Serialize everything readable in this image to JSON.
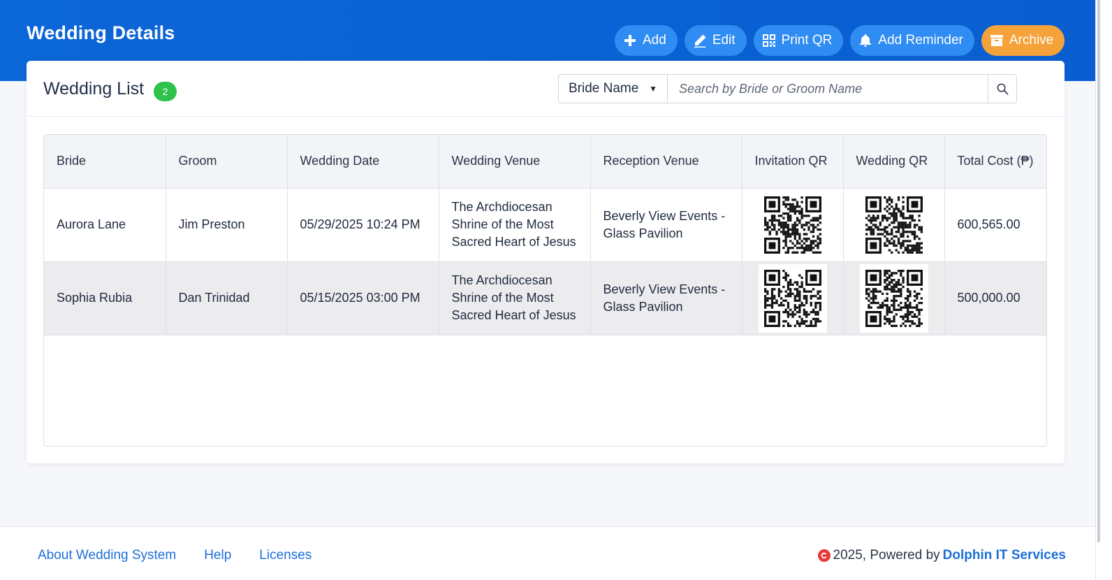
{
  "page": {
    "title": "Wedding Details"
  },
  "toolbar": {
    "add_label": "Add",
    "edit_label": "Edit",
    "print_qr_label": "Print QR",
    "add_reminder_label": "Add Reminder",
    "archive_label": "Archive"
  },
  "colors": {
    "header_blue": "#0b66d8",
    "button_blue": "#2f8cf2",
    "archive_orange": "#f5a23b",
    "badge_green": "#2ec24a",
    "link_blue": "#1c6fd8"
  },
  "list": {
    "title": "Wedding List",
    "count": "2",
    "filter_selected": "Bride Name",
    "search_placeholder": "Search by Bride or Groom Name"
  },
  "table": {
    "columns": {
      "bride": "Bride",
      "groom": "Groom",
      "wedding_date": "Wedding Date",
      "wedding_venue": "Wedding Venue",
      "reception_venue": "Reception Venue",
      "invitation_qr": "Invitation QR",
      "wedding_qr": "Wedding QR",
      "total_cost": "Total Cost (₱)"
    },
    "rows": [
      {
        "bride": "Aurora Lane",
        "groom": "Jim Preston",
        "wedding_date": "05/29/2025 10:24 PM",
        "wedding_venue": "The Archdiocesan Shrine of the Most Sacred Heart of Jesus",
        "reception_venue": "Beverly View Events - Glass Pavilion",
        "invitation_qr": "qr-code-icon",
        "wedding_qr": "qr-code-icon",
        "total_cost": "600,565.00"
      },
      {
        "bride": "Sophia Rubia",
        "groom": "Dan Trinidad",
        "wedding_date": "05/15/2025 03:00 PM",
        "wedding_venue": "The Archdiocesan Shrine of the Most Sacred Heart of Jesus",
        "reception_venue": "Beverly View Events - Glass Pavilion",
        "invitation_qr": "qr-code-icon",
        "wedding_qr": "qr-code-icon",
        "total_cost": "500,000.00"
      }
    ]
  },
  "footer": {
    "links": [
      "About Wedding System",
      "Help",
      "Licenses"
    ],
    "copyright_text": "2025, Powered by",
    "company": "Dolphin IT Services"
  }
}
